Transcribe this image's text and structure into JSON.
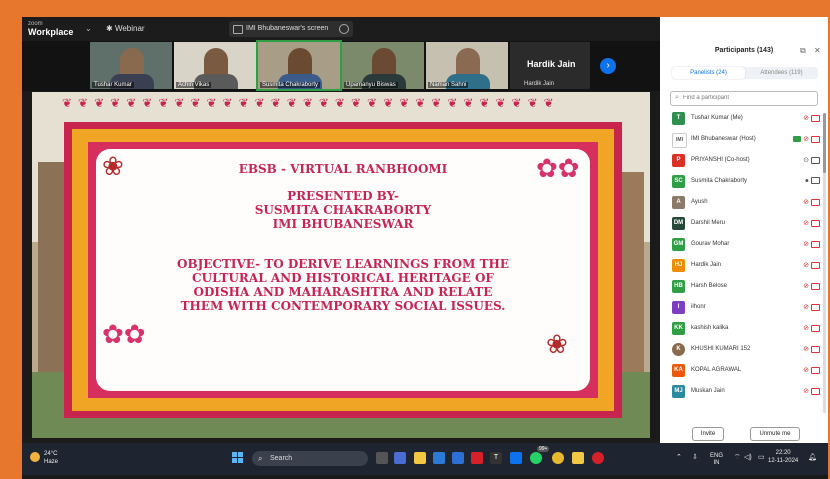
{
  "window": {
    "app_name_top": "zoom",
    "app_name": "Workplace",
    "meeting_type": "Webinar",
    "share_label": "IMI Bhubaneswar's screen",
    "controls": [
      "–",
      "❐",
      "✕"
    ]
  },
  "video_strip": {
    "tiles": [
      {
        "name": "Tushar Kumar"
      },
      {
        "name": "Achin Vikas"
      },
      {
        "name": "Susmita Chakraborty"
      },
      {
        "name": "Upamanyu Biswas"
      },
      {
        "name": "Naman Sahni"
      }
    ],
    "speaker_tile": {
      "big_name": "Hardik Jain",
      "small_name": "Hardik Jain"
    }
  },
  "slide": {
    "title": "EBSB - VIRTUAL RANBHOOMI",
    "presented_by": "PRESENTED BY-",
    "presenter": "SUSMITA CHAKRABORTY",
    "institute": "IMI BHUBANESWAR",
    "objective_lines": [
      "OBJECTIVE- TO DERIVE LEARNINGS FROM THE",
      "CULTURAL AND HISTORICAL HERITAGE OF",
      "ODISHA AND MAHARASHTRA AND RELATE",
      "THEM WITH CONTEMPORARY SOCIAL ISSUES."
    ]
  },
  "participants_panel": {
    "title": "Participants (143)",
    "tabs": {
      "panelists": "Panelists (24)",
      "attendees": "Attendees (119)"
    },
    "search_placeholder": "Find a participant",
    "invite_label": "Invite",
    "unmute_label": "Unmute me",
    "list": [
      {
        "initials": "T",
        "name": "Tushar Kumar (Me)",
        "color": "#2f8f4e"
      },
      {
        "initials": "IMI",
        "name": "IMI Bhubaneswar (Host)",
        "color": "#ffffff"
      },
      {
        "initials": "P",
        "name": "PRIYANSHI (Co-host)",
        "color": "#d93025"
      },
      {
        "initials": "SC",
        "name": "Susmita Chakraborty",
        "color": "#2f9e44"
      },
      {
        "initials": "A",
        "name": "Ayush",
        "color": "#8a7a6a"
      },
      {
        "initials": "DM",
        "name": "Darshil Meru",
        "color": "#264a3a"
      },
      {
        "initials": "GM",
        "name": "Gourav Mohar",
        "color": "#2f9e44"
      },
      {
        "initials": "HJ",
        "name": "Hardik Jain",
        "color": "#f08c00"
      },
      {
        "initials": "HB",
        "name": "Harsh Belose",
        "color": "#2f9e44"
      },
      {
        "initials": "I",
        "name": "ilhonr",
        "color": "#7b3fbf"
      },
      {
        "initials": "KK",
        "name": "kashish kalika",
        "color": "#2f9e44"
      },
      {
        "initials": "K",
        "name": "KHUSHI KUMARI 152",
        "color": "#8a6a4e"
      },
      {
        "initials": "KA",
        "name": "KOPAL AGRAWAL",
        "color": "#e8590c"
      },
      {
        "initials": "MJ",
        "name": "Muskan Jain",
        "color": "#2b8a9e"
      }
    ]
  },
  "taskbar": {
    "temperature": "24°C",
    "weather": "Haze",
    "search_label": "Search",
    "badge": "99+",
    "lang_top": "ENG",
    "lang_bottom": "IN",
    "time": "22:20",
    "date": "12-11-2024"
  }
}
